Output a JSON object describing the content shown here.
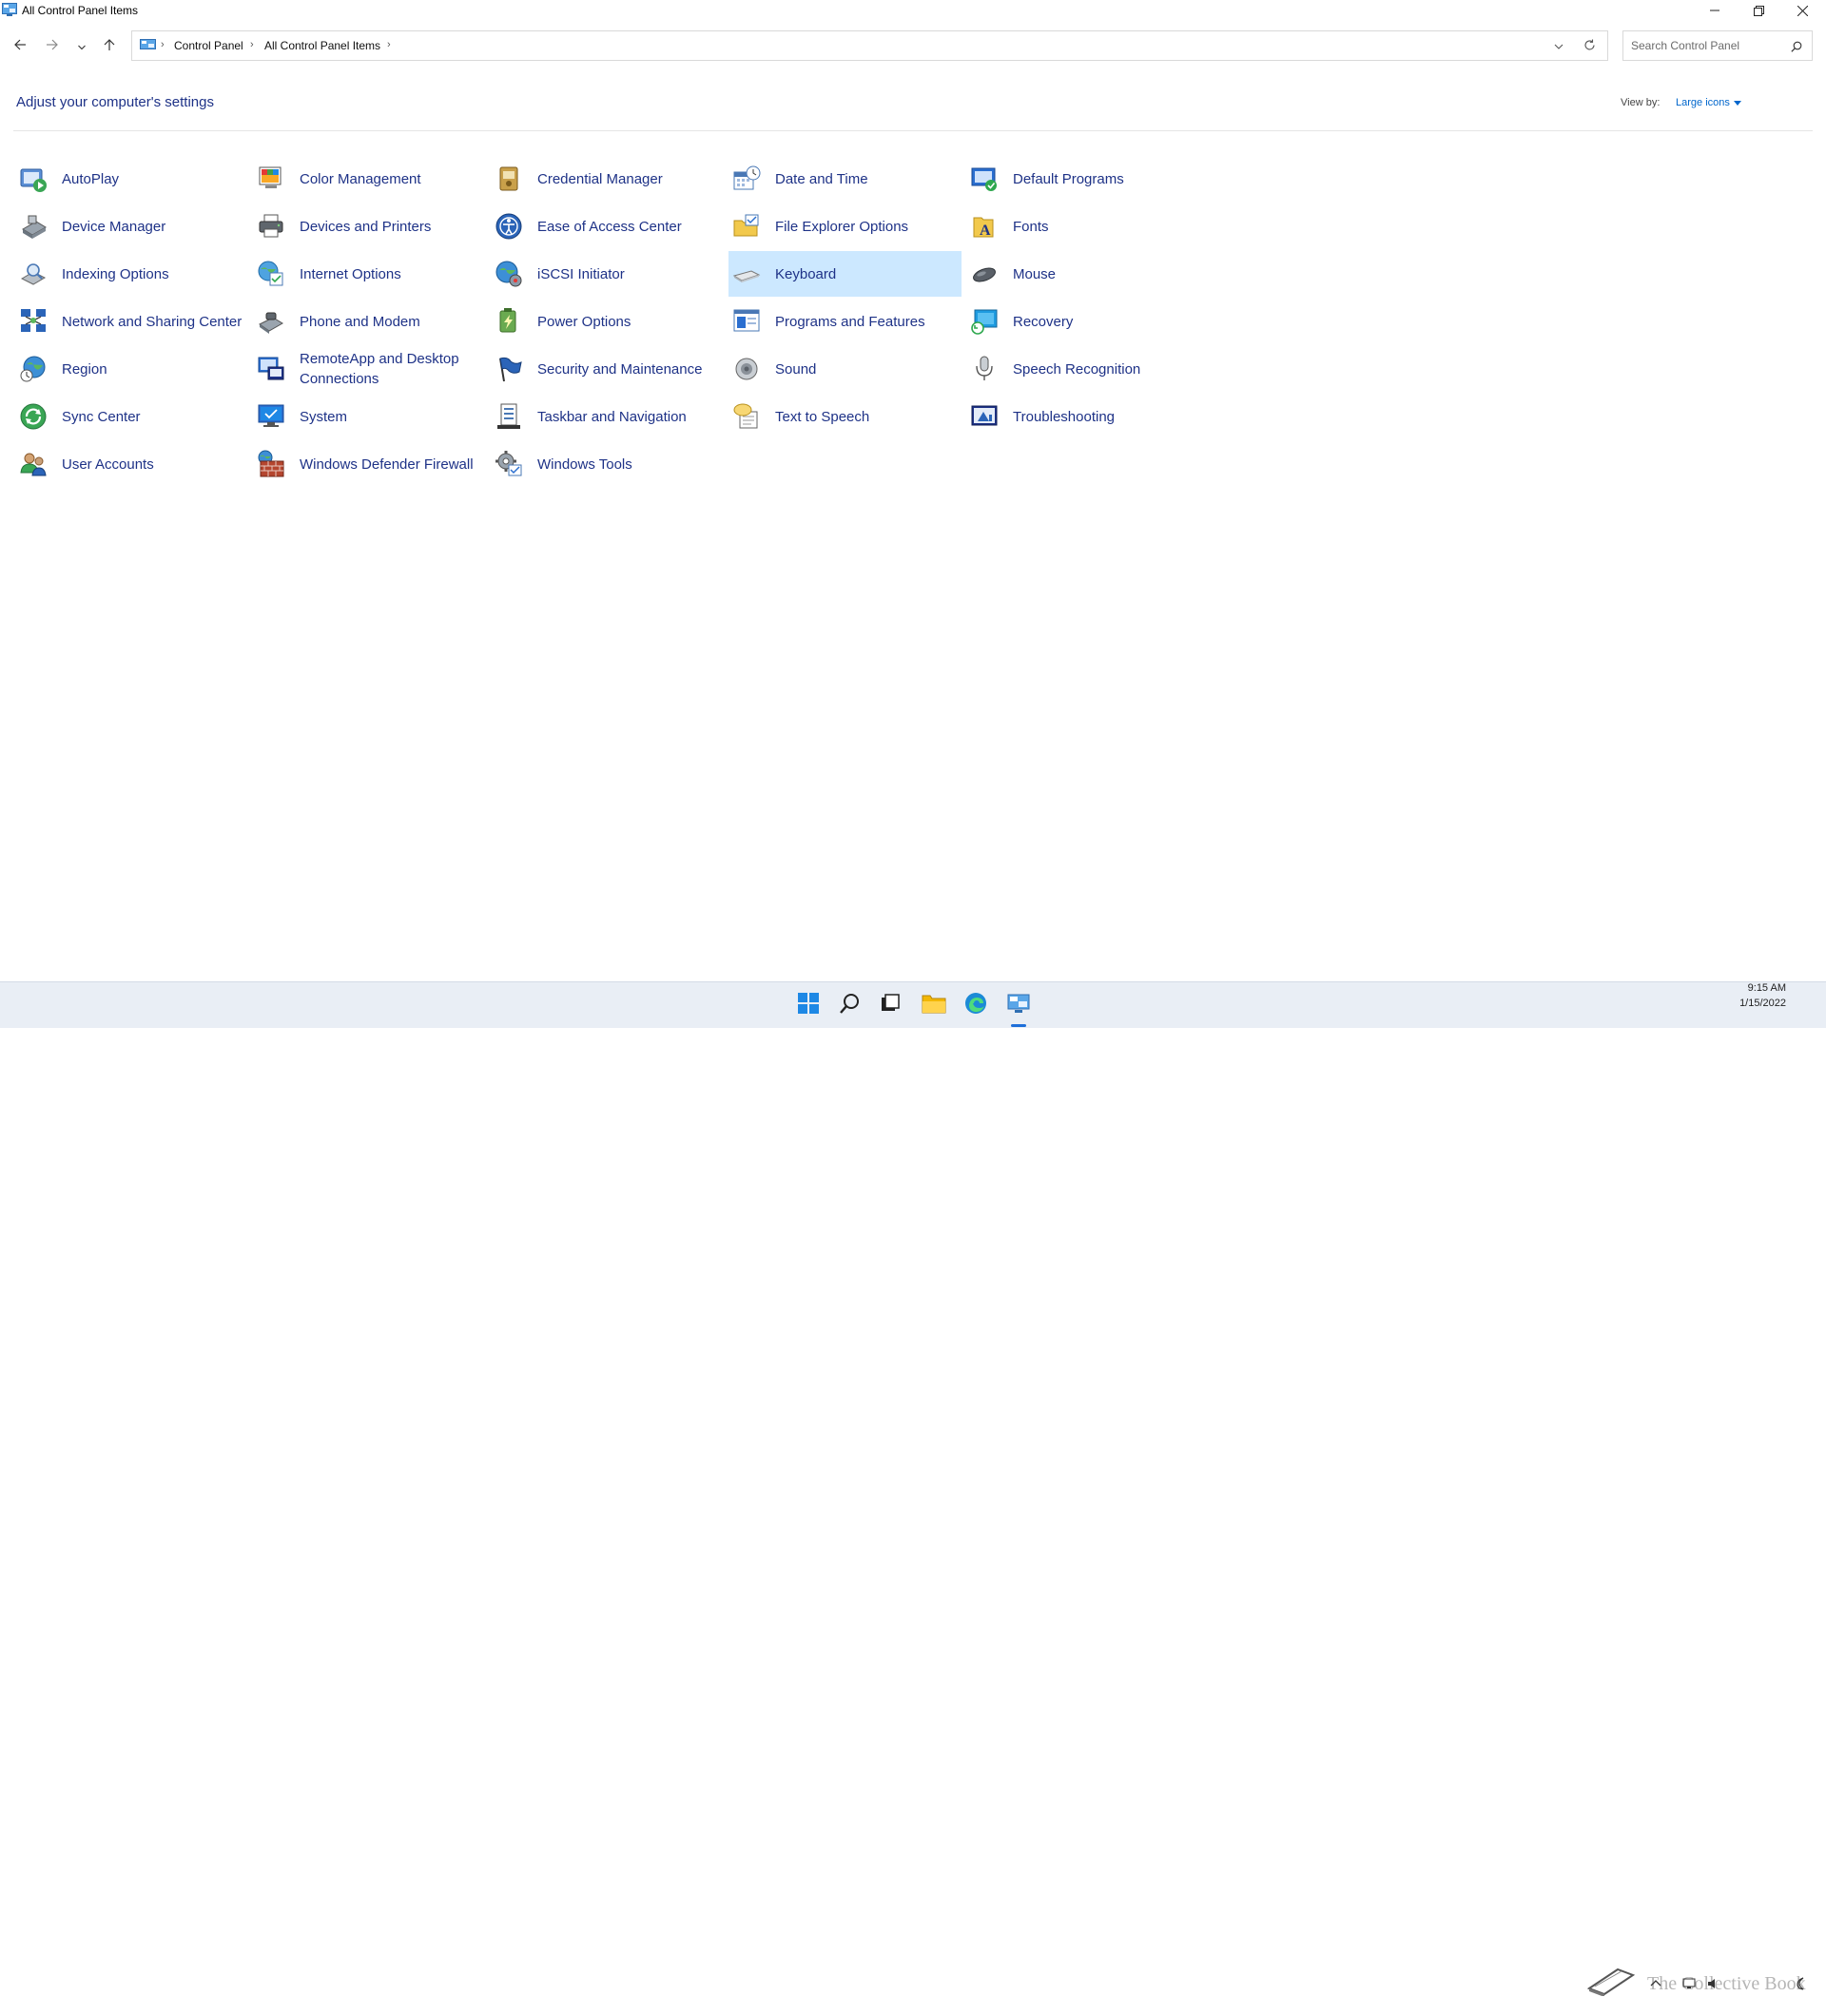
{
  "window": {
    "title": "All Control Panel Items",
    "minimize_icon": "minimize-icon",
    "maximize_icon": "restore-icon",
    "close_icon": "close-icon"
  },
  "nav": {
    "breadcrumbs": [
      "Control Panel",
      "All Control Panel Items"
    ],
    "search_placeholder": "Search Control Panel"
  },
  "header": {
    "title": "Adjust your computer's settings",
    "view_by_label": "View by:",
    "view_by_value": "Large icons"
  },
  "items": [
    {
      "label": "AutoPlay",
      "icon": "autoplay-icon"
    },
    {
      "label": "Color Management",
      "icon": "color-management-icon"
    },
    {
      "label": "Credential Manager",
      "icon": "credential-manager-icon"
    },
    {
      "label": "Date and Time",
      "icon": "date-time-icon"
    },
    {
      "label": "Default Programs",
      "icon": "default-programs-icon"
    },
    {
      "label": "Device Manager",
      "icon": "device-manager-icon"
    },
    {
      "label": "Devices and Printers",
      "icon": "printer-icon"
    },
    {
      "label": "Ease of Access Center",
      "icon": "ease-of-access-icon"
    },
    {
      "label": "File Explorer Options",
      "icon": "folder-options-icon"
    },
    {
      "label": "Fonts",
      "icon": "fonts-icon"
    },
    {
      "label": "Indexing Options",
      "icon": "indexing-icon"
    },
    {
      "label": "Internet Options",
      "icon": "internet-options-icon"
    },
    {
      "label": "iSCSI Initiator",
      "icon": "iscsi-icon"
    },
    {
      "label": "Keyboard",
      "icon": "keyboard-icon",
      "selected": true
    },
    {
      "label": "Mouse",
      "icon": "mouse-icon"
    },
    {
      "label": "Network and Sharing Center",
      "icon": "network-icon"
    },
    {
      "label": "Phone and Modem",
      "icon": "phone-icon"
    },
    {
      "label": "Power Options",
      "icon": "power-icon"
    },
    {
      "label": "Programs and Features",
      "icon": "programs-icon"
    },
    {
      "label": "Recovery",
      "icon": "recovery-icon"
    },
    {
      "label": "Region",
      "icon": "region-icon"
    },
    {
      "label": "RemoteApp and Desktop Connections",
      "icon": "remoteapp-icon"
    },
    {
      "label": "Security and Maintenance",
      "icon": "security-flag-icon"
    },
    {
      "label": "Sound",
      "icon": "speaker-icon"
    },
    {
      "label": "Speech Recognition",
      "icon": "microphone-icon"
    },
    {
      "label": "Sync Center",
      "icon": "sync-icon"
    },
    {
      "label": "System",
      "icon": "system-monitor-icon"
    },
    {
      "label": "Taskbar and Navigation",
      "icon": "taskbar-icon"
    },
    {
      "label": "Text to Speech",
      "icon": "text-to-speech-icon"
    },
    {
      "label": "Troubleshooting",
      "icon": "troubleshooting-icon"
    },
    {
      "label": "User Accounts",
      "icon": "user-accounts-icon"
    },
    {
      "label": "Windows Defender Firewall",
      "icon": "firewall-icon"
    },
    {
      "label": "Windows Tools",
      "icon": "windows-tools-icon"
    }
  ],
  "taskbar": {
    "apps": [
      "start-icon",
      "search-icon",
      "task-view-icon",
      "file-explorer-icon",
      "edge-icon",
      "control-panel-icon"
    ],
    "time": "9:15 AM",
    "date": "1/15/2022",
    "watermark": "The Collective Book"
  },
  "colors": {
    "link": "#1e3287",
    "selected_bg": "#cce8ff",
    "accent": "#0066cc"
  }
}
